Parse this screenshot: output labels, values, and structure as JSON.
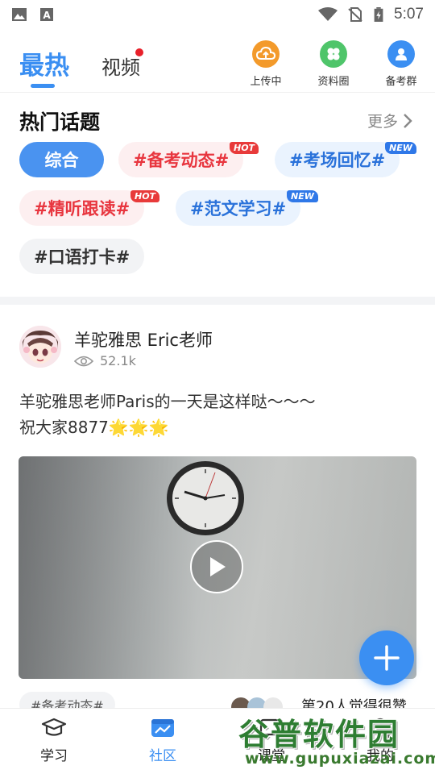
{
  "status_bar": {
    "time": "5:07",
    "left_icons": [
      "image-icon",
      "a-text-icon"
    ],
    "right_icons": [
      "wifi-icon",
      "no-sim-icon",
      "battery-charging-icon"
    ]
  },
  "top_nav": {
    "tabs": [
      {
        "label": "最热",
        "active": true
      },
      {
        "label": "视频",
        "active": false,
        "has_dot": true
      }
    ],
    "actions": [
      {
        "label": "上传中",
        "icon": "cloud-upload-icon",
        "color": "#f39a2b"
      },
      {
        "label": "资料圈",
        "icon": "clover-icon",
        "color": "#4fc56a"
      },
      {
        "label": "备考群",
        "icon": "user-group-icon",
        "color": "#3b8ff2"
      }
    ]
  },
  "hot_topics": {
    "title": "热门话题",
    "more_label": "更多",
    "chips": [
      {
        "label": "综合",
        "style": "active",
        "badge": ""
      },
      {
        "label": "#备考动态#",
        "style": "red",
        "badge": "HOT"
      },
      {
        "label": "#考场回忆#",
        "style": "blue",
        "badge": "NEW"
      },
      {
        "label": "#精听跟读#",
        "style": "red",
        "badge": "HOT"
      },
      {
        "label": "#范文学习#",
        "style": "blue",
        "badge": "NEW"
      },
      {
        "label": "#口语打卡#",
        "style": "gray",
        "badge": ""
      }
    ]
  },
  "post": {
    "author": "羊驼雅思 Eric老师",
    "views": "52.1k",
    "text_line1": "羊驼雅思老师Paris的一天是这样哒～～～",
    "text_line2": "祝大家8877🌟🌟🌟",
    "tag": "#备考动态#",
    "related_title": "第20人觉得很赞"
  },
  "bottom_nav": {
    "items": [
      {
        "label": "学习",
        "icon": "graduation-cap-icon",
        "active": false
      },
      {
        "label": "社区",
        "icon": "community-chart-icon",
        "active": true
      },
      {
        "label": "课堂",
        "icon": "classroom-icon",
        "active": false
      },
      {
        "label": "我的",
        "icon": "profile-icon",
        "active": false
      }
    ]
  },
  "watermark": {
    "text": "谷普软件园",
    "url": "www.gupuxiazai.com"
  },
  "colors": {
    "accent": "#3b8ff2",
    "hot": "#e83a3a",
    "new": "#2f78e8"
  }
}
